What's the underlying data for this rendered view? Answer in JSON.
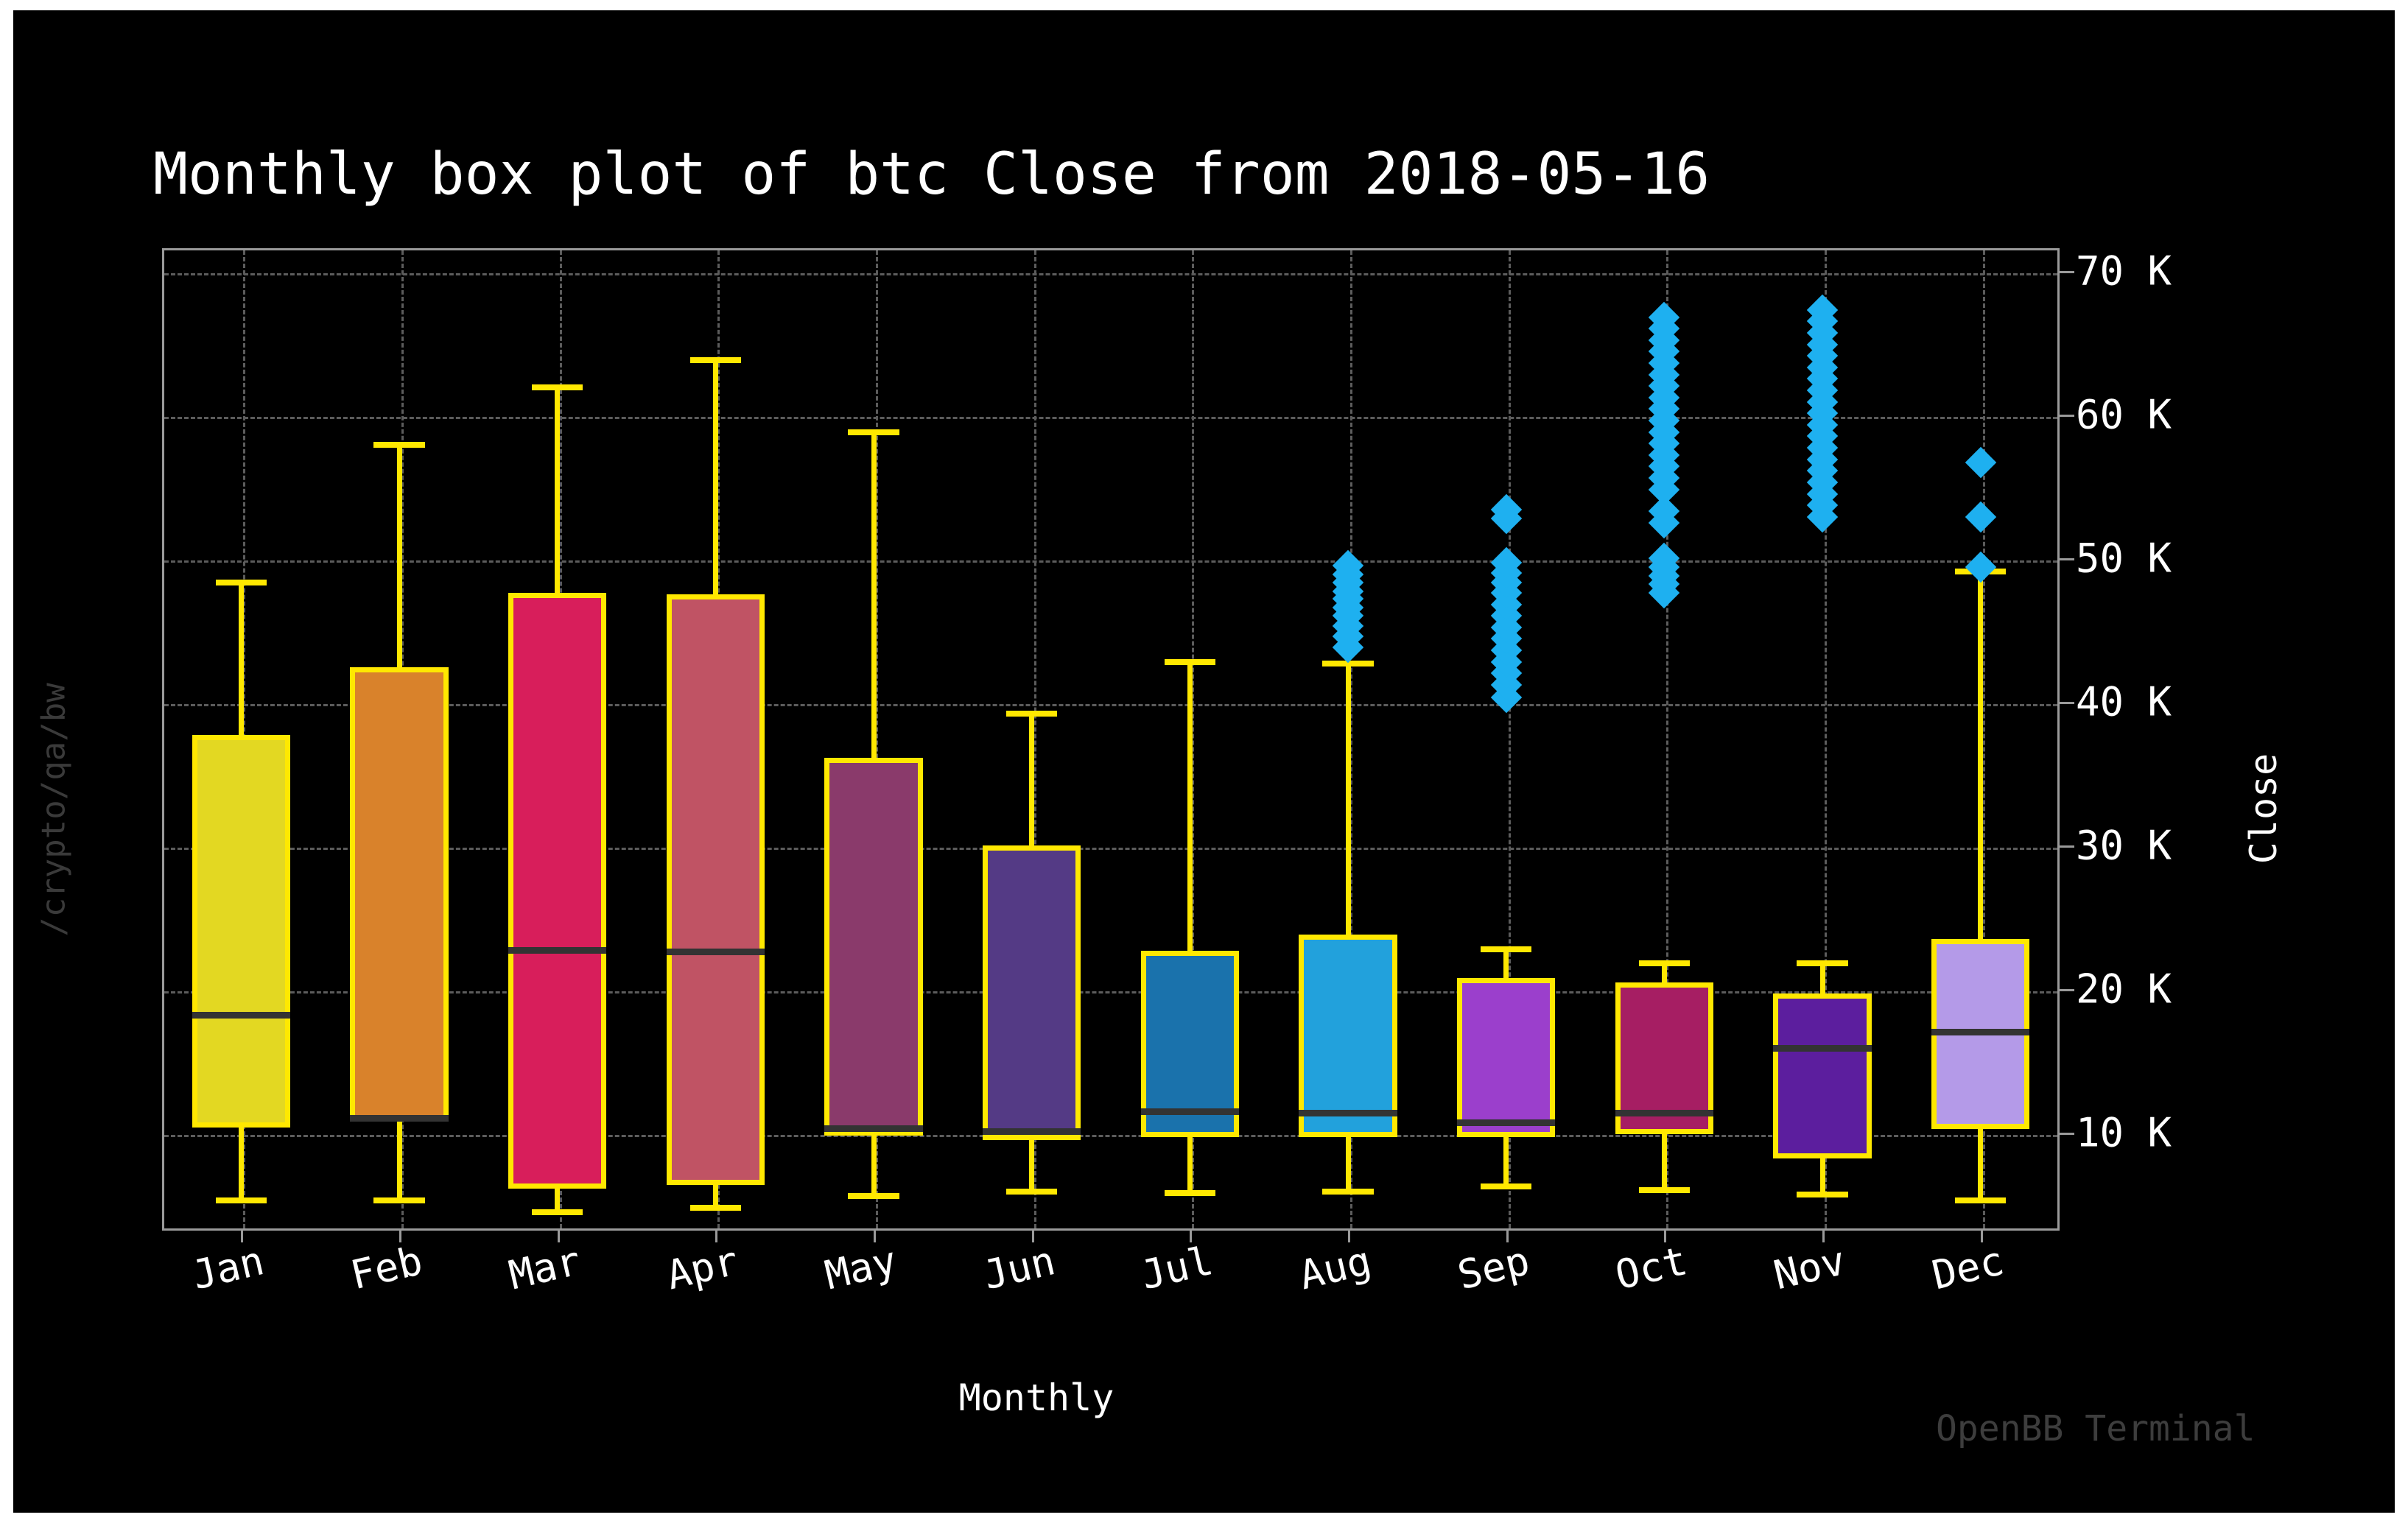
{
  "figure": {
    "background": "#000000",
    "page_background": "#ffffff",
    "watermark": "OpenBB Terminal",
    "path_label": "/crypto/qa/bw"
  },
  "chart_data": {
    "type": "box",
    "title": "Monthly box plot of btc Close from 2018-05-16",
    "xlabel": "Monthly",
    "ylabel": "Close",
    "grid": true,
    "legend": null,
    "ylim": [
      3200,
      71600
    ],
    "yticks": [
      10000,
      20000,
      30000,
      40000,
      50000,
      60000,
      70000
    ],
    "ytick_labels": [
      "10 K",
      "20 K",
      "30 K",
      "40 K",
      "50 K",
      "60 K",
      "70 K"
    ],
    "categories": [
      "Jan",
      "Feb",
      "Mar",
      "Apr",
      "May",
      "Jun",
      "Jul",
      "Aug",
      "Sep",
      "Oct",
      "Nov",
      "Dec"
    ],
    "box_edge_color": "#ffe800",
    "median_color": "#333333",
    "flier_color": "#1eb0f0",
    "boxes": [
      {
        "label": "Jan",
        "color": "#e3d822",
        "whisker_low": 5300,
        "q1": 10400,
        "median": 18200,
        "q3": 37700,
        "whisker_high": 48300,
        "fliers": []
      },
      {
        "label": "Feb",
        "color": "#d9822b",
        "whisker_low": 5300,
        "q1": 10800,
        "median": 11000,
        "q3": 42400,
        "whisker_high": 57900,
        "fliers": []
      },
      {
        "label": "Mar",
        "color": "#d81e5b",
        "whisker_low": 4500,
        "q1": 6100,
        "median": 22700,
        "q3": 47600,
        "whisker_high": 61900,
        "fliers": []
      },
      {
        "label": "Apr",
        "color": "#c05364",
        "whisker_low": 4800,
        "q1": 6400,
        "median": 22600,
        "q3": 47500,
        "whisker_high": 63800,
        "fliers": []
      },
      {
        "label": "May",
        "color": "#8a3a6b",
        "whisker_low": 5600,
        "q1": 9800,
        "median": 10300,
        "q3": 36100,
        "whisker_high": 58800,
        "fliers": []
      },
      {
        "label": "Jun",
        "color": "#543a85",
        "whisker_low": 5900,
        "q1": 9500,
        "median": 10100,
        "q3": 30000,
        "whisker_high": 39200,
        "fliers": []
      },
      {
        "label": "Jul",
        "color": "#1a72ac",
        "whisker_low": 5800,
        "q1": 9700,
        "median": 11500,
        "q3": 22700,
        "whisker_high": 42800,
        "fliers": []
      },
      {
        "label": "Aug",
        "color": "#22a1dc",
        "whisker_low": 5900,
        "q1": 9700,
        "median": 11400,
        "q3": 23800,
        "whisker_high": 42700,
        "fliers": [
          43800,
          44600,
          45300,
          46000,
          46600,
          47200,
          47700,
          48300,
          48900,
          49500
        ]
      },
      {
        "label": "Sep",
        "color": "#9b3fcc",
        "whisker_low": 6300,
        "q1": 9700,
        "median": 10700,
        "q3": 20800,
        "whisker_high": 22800,
        "fliers": [
          40300,
          41200,
          42000,
          42800,
          43600,
          44400,
          45200,
          46000,
          46800,
          47600,
          48300,
          49000,
          49700,
          52800,
          53400
        ]
      },
      {
        "label": "Oct",
        "color": "#a61e63",
        "whisker_low": 6000,
        "q1": 9900,
        "median": 11400,
        "q3": 20500,
        "whisker_high": 21800,
        "fliers": [
          47600,
          48200,
          48800,
          49400,
          50000,
          52500,
          53300,
          54800,
          55600,
          56400,
          57200,
          58000,
          58800,
          59600,
          60400,
          61200,
          62000,
          62800,
          63600,
          64400,
          65200,
          66000,
          66800
        ]
      },
      {
        "label": "Nov",
        "color": "#5c1e9e",
        "whisker_low": 5700,
        "q1": 8200,
        "median": 15900,
        "q3": 19700,
        "whisker_high": 21800,
        "fliers": [
          52900,
          53700,
          54500,
          55300,
          56100,
          56900,
          57700,
          58500,
          59300,
          60100,
          60900,
          61700,
          62500,
          63300,
          64100,
          64900,
          65700,
          66500,
          67300
        ]
      },
      {
        "label": "Dec",
        "color": "#b49ae8",
        "whisker_low": 5300,
        "q1": 10300,
        "median": 17000,
        "q3": 23500,
        "whisker_high": 49100,
        "fliers": [
          49400,
          52900,
          56700
        ]
      }
    ]
  }
}
